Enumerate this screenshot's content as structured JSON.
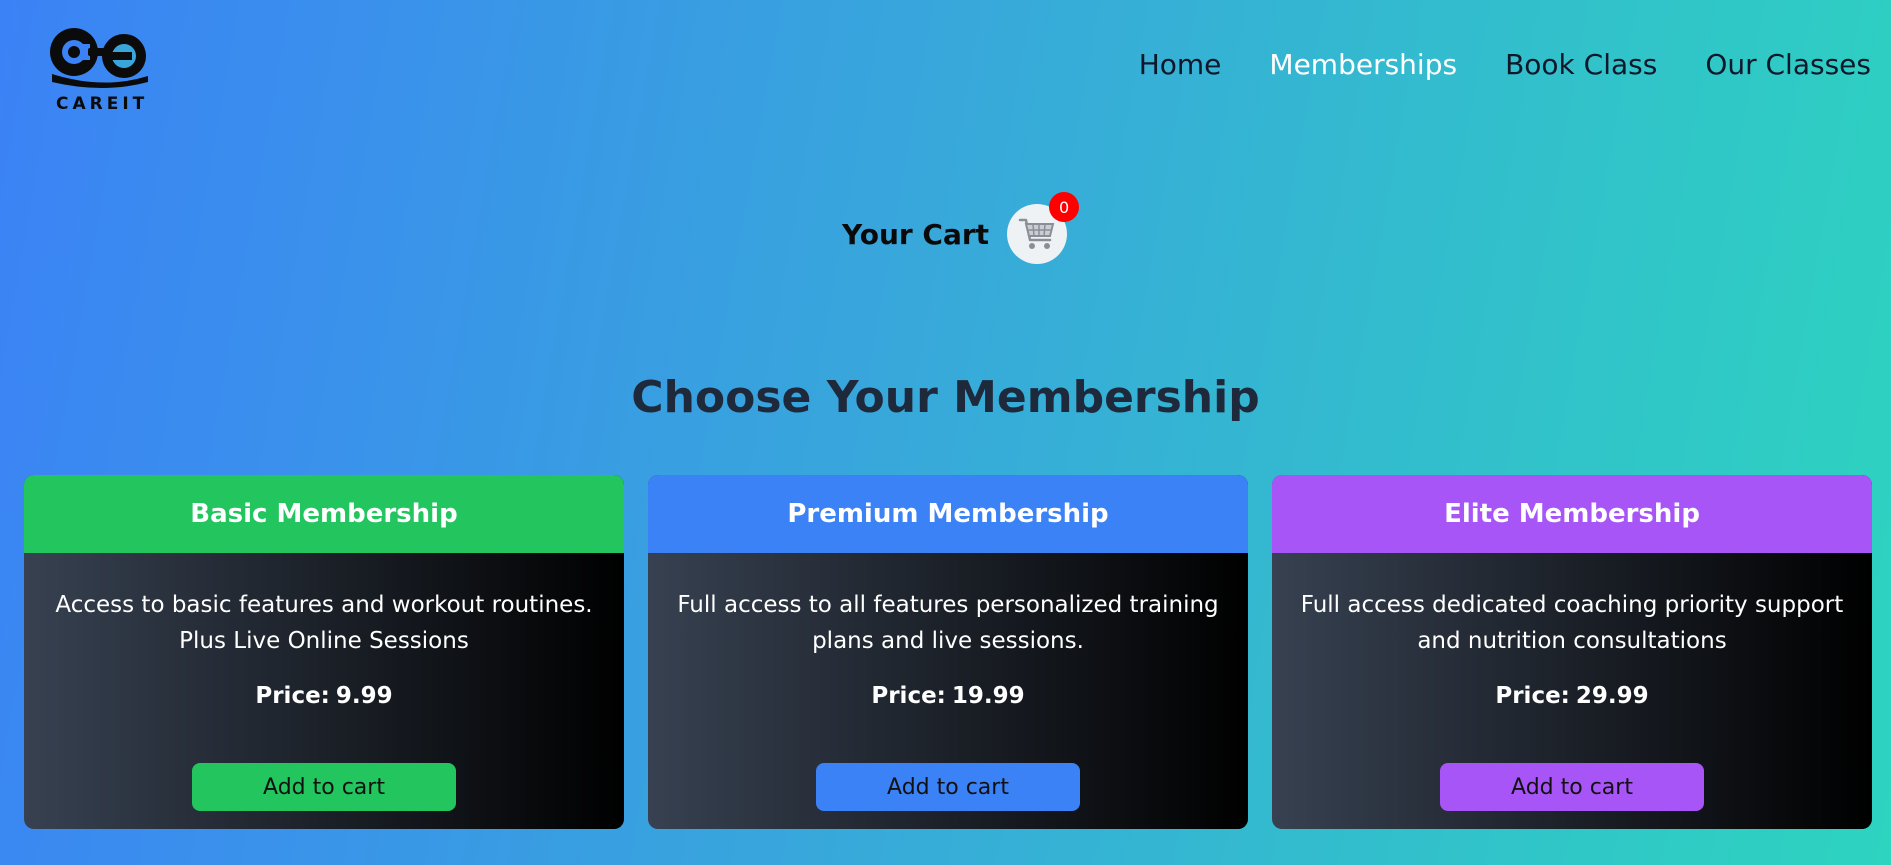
{
  "brand": {
    "name": "CAREIT",
    "logo_icon": "dumbbell-logo-icon"
  },
  "nav": {
    "items": [
      {
        "label": "Home",
        "active": false
      },
      {
        "label": "Memberships",
        "active": true
      },
      {
        "label": "Book Class",
        "active": false
      },
      {
        "label": "Our Classes",
        "active": false
      }
    ]
  },
  "cart": {
    "label": "Your Cart",
    "count": "0",
    "icon": "shopping-cart-icon"
  },
  "section": {
    "title": "Choose Your Membership"
  },
  "price_label": "Price:",
  "plans": [
    {
      "name": "Basic Membership",
      "description": "Access to basic features and workout routines. Plus Live Online Sessions",
      "price": "9.99",
      "button": "Add to cart",
      "color": "#22c55e"
    },
    {
      "name": "Premium Membership",
      "description": "Full access to all features personalized training plans and live sessions.",
      "price": "19.99",
      "button": "Add to cart",
      "color": "#3b82f6"
    },
    {
      "name": "Elite Membership",
      "description": "Full access dedicated coaching priority support and nutrition consultations",
      "price": "29.99",
      "button": "Add to cart",
      "color": "#a855f7"
    }
  ],
  "colors": {
    "background_start": "#3b82f6",
    "background_end": "#2dd4bf",
    "badge": "#ff0000",
    "title": "#1e293b"
  }
}
